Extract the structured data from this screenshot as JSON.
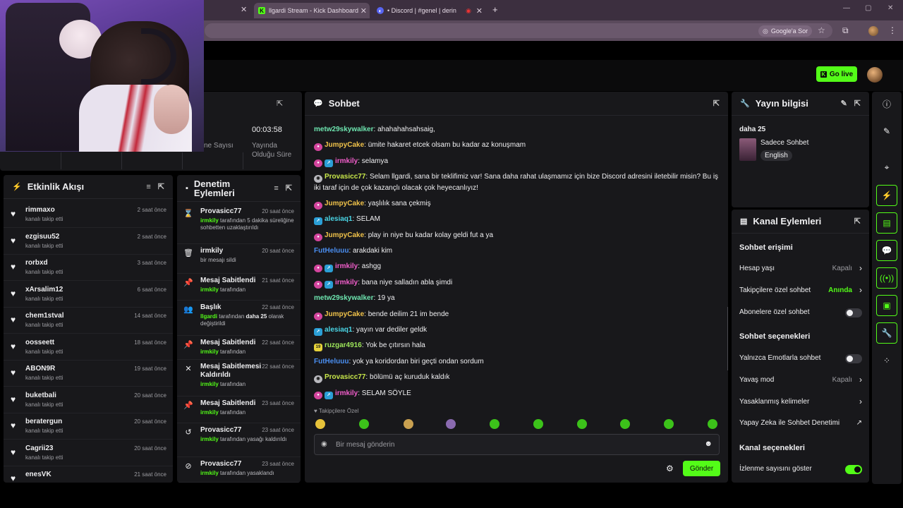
{
  "browser": {
    "tabs": [
      {
        "label": "llgardi Stream - Kick Dashboard",
        "active": true
      },
      {
        "label": "• Discord | #genel | derin com",
        "active": false
      }
    ],
    "google_sor": "Google'a Sor"
  },
  "header": {
    "go_live": "Go live"
  },
  "stats": {
    "viewers_label_partial": "ne Sayısı",
    "uptime_value": "00:03:58",
    "uptime_label_1": "Yayında",
    "uptime_label_2": "Olduğu Süre"
  },
  "activity": {
    "title": "Etkinlik Akışı",
    "items": [
      {
        "user": "rimmaxo",
        "desc": "kanalı takip etti",
        "time": "2 saat önce"
      },
      {
        "user": "ezgisuu52",
        "desc": "kanalı takip etti",
        "time": "2 saat önce"
      },
      {
        "user": "rorbxd",
        "desc": "kanalı takip etti",
        "time": "3 saat önce"
      },
      {
        "user": "xArsalim12",
        "desc": "kanalı takip etti",
        "time": "6 saat önce"
      },
      {
        "user": "chem1stval",
        "desc": "kanalı takip etti",
        "time": "14 saat önce"
      },
      {
        "user": "oosseett",
        "desc": "kanalı takip etti",
        "time": "18 saat önce"
      },
      {
        "user": "ABON9R",
        "desc": "kanalı takip etti",
        "time": "19 saat önce"
      },
      {
        "user": "buketbali",
        "desc": "kanalı takip etti",
        "time": "20 saat önce"
      },
      {
        "user": "beratergun",
        "desc": "kanalı takip etti",
        "time": "20 saat önce"
      },
      {
        "user": "Cagrii23",
        "desc": "kanalı takip etti",
        "time": "20 saat önce"
      },
      {
        "user": "enesVK",
        "desc": "",
        "time": "21 saat önce"
      }
    ]
  },
  "moderation": {
    "title_1": "Denetim",
    "title_2": "Eylemleri",
    "items": [
      {
        "icon": "hourglass-icon",
        "glyph": "⌛",
        "title": "Provasicc77",
        "time": "20 saat önce",
        "who": "irmkily",
        "rest": " tarafından 5 dakika süreliğine sohbetten uzaklaştırıldı"
      },
      {
        "icon": "trash-icon",
        "glyph": "🗑",
        "title": "irmkily",
        "time": "20 saat önce",
        "who": "",
        "rest": "bir mesajı sildi"
      },
      {
        "icon": "pin-icon",
        "glyph": "📌",
        "title": "Mesaj Sabitlendi",
        "time": "21 saat önce",
        "who": "irmkily",
        "rest": " tarafından"
      },
      {
        "icon": "title-change-icon",
        "glyph": "👥",
        "title": "Başlık",
        "time": "22 saat önce",
        "who": "llgardi",
        "rest": " tarafından ",
        "bold": "daha 25",
        "rest2": " olarak değiştirildi"
      },
      {
        "icon": "pin-icon",
        "glyph": "📌",
        "title": "Mesaj Sabitlendi",
        "time": "22 saat önce",
        "who": "irmkily",
        "rest": " tarafından"
      },
      {
        "icon": "unpin-icon",
        "glyph": "✕",
        "title": "Mesaj Sabitlemesi Kaldırıldı",
        "time": "22 saat önce",
        "who": "irmkily",
        "rest": " tarafından"
      },
      {
        "icon": "pin-icon",
        "glyph": "📌",
        "title": "Mesaj Sabitlendi",
        "time": "23 saat önce",
        "who": "irmkily",
        "rest": " tarafından"
      },
      {
        "icon": "undo-icon",
        "glyph": "↺",
        "title": "Provasicc77",
        "time": "23 saat önce",
        "who": "irmkily",
        "rest": " tarafından yasağı kaldırıldı"
      },
      {
        "icon": "ban-icon",
        "glyph": "⊘",
        "title": "Provasicc77",
        "time": "23 saat önce",
        "who": "irmkily",
        "rest": " tarafından yasaklandı"
      }
    ]
  },
  "chat": {
    "title": "Sohbet",
    "messages": [
      {
        "badges": [],
        "user": "metw29skywalker",
        "color": "u-teal",
        "text": ": ahahahahsahsaig,"
      },
      {
        "badges": [
          "sub"
        ],
        "user": "JumpyCake",
        "color": "u-yellow",
        "text": ": ümite hakaret etcek olsam bu kadar az konuşmam"
      },
      {
        "badges": [
          "sub",
          "mod"
        ],
        "user": "irmkily",
        "color": "u-pink",
        "text": ": selamya"
      },
      {
        "badges": [
          "grey"
        ],
        "user": "Provasicc77",
        "color": "u-lime",
        "text": ": Selam llgardi, sana bir teklifimiz var! Sana daha rahat ulaşmamız için bize Discord adresini iletebilir misin? Bu iş iki taraf için de çok kazançlı olacak çok heyecanlıyız!"
      },
      {
        "badges": [
          "sub"
        ],
        "user": "JumpyCake",
        "color": "u-yellow",
        "text": ": yaşlılık sana çekmiş"
      },
      {
        "badges": [
          "mod"
        ],
        "user": "alesiaq1",
        "color": "u-cyan",
        "text": ": SELAM"
      },
      {
        "badges": [
          "sub"
        ],
        "user": "JumpyCake",
        "color": "u-yellow",
        "text": ": play in niye bu kadar kolay geldi fut a ya"
      },
      {
        "badges": [],
        "user": "FutHeluuu",
        "color": "u-blue",
        "text": ": arakdaki kim"
      },
      {
        "badges": [
          "sub",
          "mod"
        ],
        "user": "irmkily",
        "color": "u-pink",
        "text": ": ashgg"
      },
      {
        "badges": [
          "sub",
          "mod"
        ],
        "user": "irmkily",
        "color": "u-pink",
        "text": ": bana niye salladın abla şimdi"
      },
      {
        "badges": [],
        "user": "metw29skywalker",
        "color": "u-teal",
        "text": ": 19 ya"
      },
      {
        "badges": [
          "sub"
        ],
        "user": "JumpyCake",
        "color": "u-yellow",
        "text": ": bende deilim 21 im bende"
      },
      {
        "badges": [
          "mod"
        ],
        "user": "alesiaq1",
        "color": "u-cyan",
        "text": ": yayın var dediler geldk"
      },
      {
        "badges": [
          "gold"
        ],
        "user": "ruzgar4916",
        "color": "u-green",
        "text": ": Yok be çıtırsın hala"
      },
      {
        "badges": [],
        "user": "FutHeluuu",
        "color": "u-blue",
        "text": ": yok ya koridordan biri geçti ondan sordum"
      },
      {
        "badges": [
          "grey"
        ],
        "user": "Provasicc77",
        "color": "u-lime",
        "text": ": bölümü aç kuruduk kaldık"
      },
      {
        "badges": [
          "sub",
          "mod"
        ],
        "user": "irmkily",
        "color": "u-pink",
        "text": ": SELAM SÖYLE"
      }
    ],
    "followers_only": "♥ Takipçilere Özel",
    "input_placeholder": "Bir mesaj gönderin",
    "send_label": "Gönder"
  },
  "stream_info": {
    "title": "Yayın bilgisi",
    "stream_title": "daha 25",
    "category": "Sadece Sohbet",
    "language": "English"
  },
  "channel_actions": {
    "title": "Kanal Eylemleri",
    "chat_access": "Sohbet erişimi",
    "age_label": "Hesap yaşı",
    "age_value": "Kapalı",
    "followers_label": "Takipçilere özel sohbet",
    "followers_value": "Anında",
    "subs_label": "Abonelere özel sohbet",
    "chat_options": "Sohbet seçenekleri",
    "emote_label": "Yalnızca Emotlarla sohbet",
    "slow_label": "Yavaş mod",
    "slow_value": "Kapalı",
    "banned_words": "Yasaklanmış kelimeler",
    "ai_mod": "Yapay Zeka ile Sohbet Denetimi",
    "channel_options": "Kanal seçenekleri",
    "viewcount_label": "İzlenme sayısını göster",
    "subs_on": false,
    "emote_on": false,
    "viewcount_on": true
  },
  "colors": {
    "accent": "#53fc18",
    "panel": "#18181b"
  }
}
